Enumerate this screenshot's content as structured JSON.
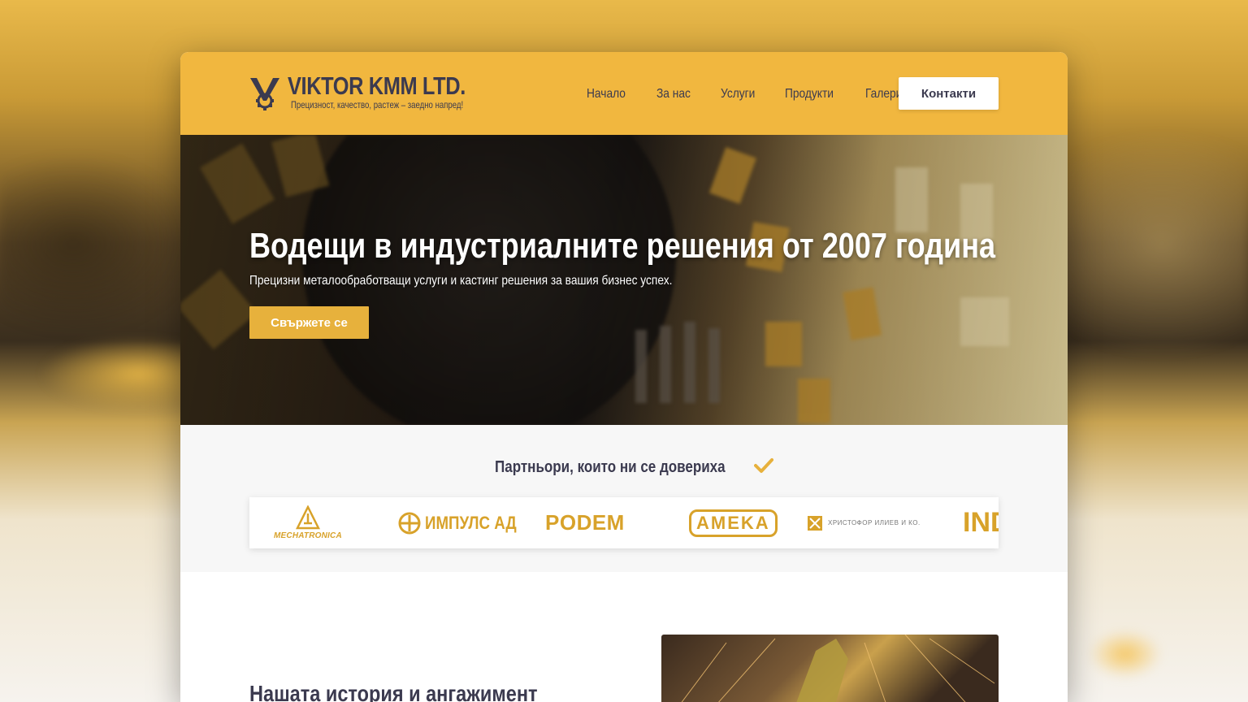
{
  "header": {
    "brand_name": "VIKTOR KMM LTD.",
    "tagline": "Прецизност, качество, растеж – заедно напред!",
    "nav": [
      "Начало",
      "За нас",
      "Услуги",
      "Продукти",
      "Галерия"
    ],
    "contact_label": "Контакти"
  },
  "hero": {
    "title": "Водещи в индустриалните решения от 2007 година",
    "subtitle": "Прецизни металообработващи услуги и кастинг решения за вашия бизнес успех.",
    "cta_label": "Свържете се"
  },
  "partners": {
    "title": "Партньори, които ни се довериха",
    "logos": {
      "mechatronica": "MECHATRONICA",
      "impuls": "ИМПУЛС АД",
      "podem": "PODEM",
      "ameka": "AMEKA",
      "hristofor": "ХРИСТОФОР ИЛИЕВ И КО.",
      "ind": "IND"
    }
  },
  "story": {
    "title": "Нашата история и ангажимент"
  },
  "colors": {
    "accent": "#f1b73f",
    "button": "#e7b13c",
    "text_dark": "#3b3a4f",
    "logo_gold": "#d8a22a"
  }
}
